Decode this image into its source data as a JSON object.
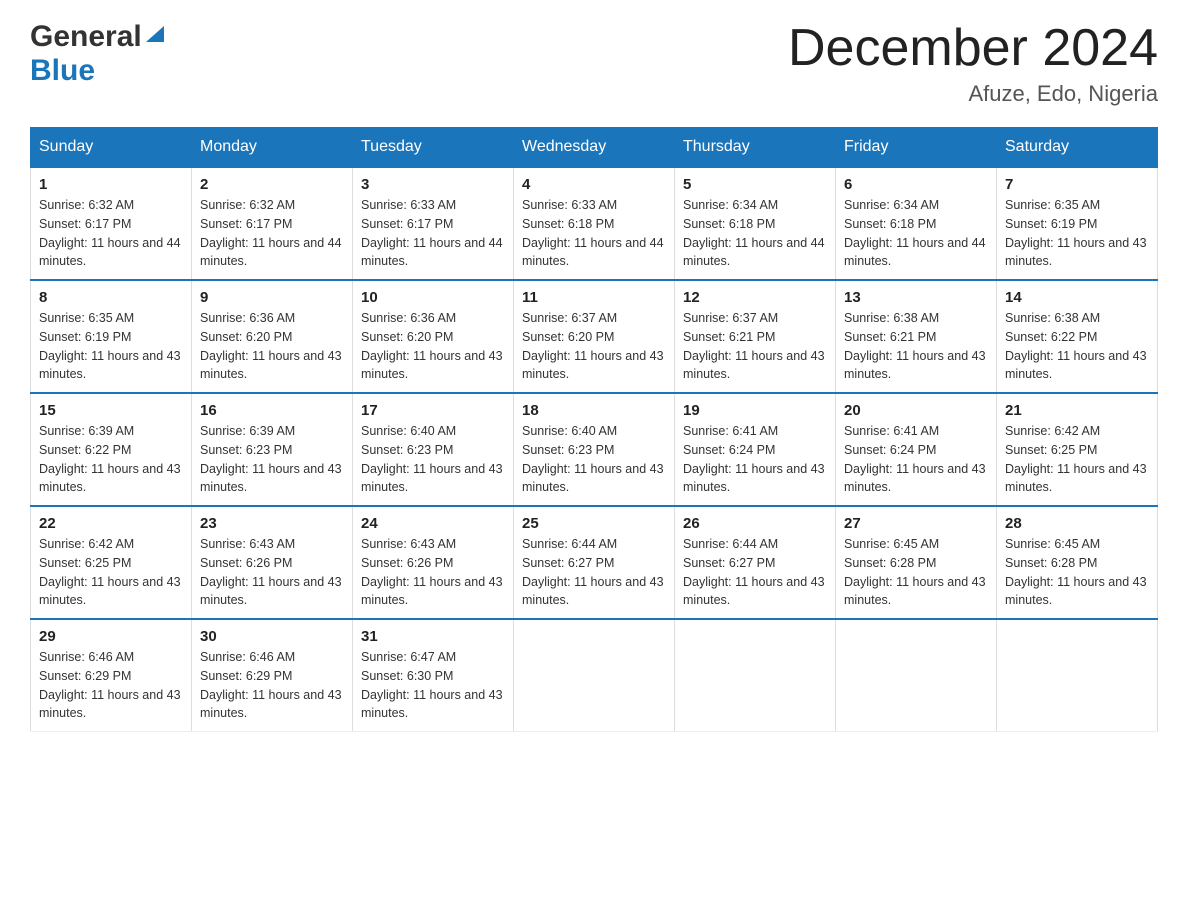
{
  "logo": {
    "general": "General",
    "blue": "Blue",
    "triangle_color": "#1a75bb"
  },
  "title": {
    "month_year": "December 2024",
    "location": "Afuze, Edo, Nigeria"
  },
  "headers": [
    "Sunday",
    "Monday",
    "Tuesday",
    "Wednesday",
    "Thursday",
    "Friday",
    "Saturday"
  ],
  "weeks": [
    [
      {
        "day": "1",
        "sunrise": "Sunrise: 6:32 AM",
        "sunset": "Sunset: 6:17 PM",
        "daylight": "Daylight: 11 hours and 44 minutes."
      },
      {
        "day": "2",
        "sunrise": "Sunrise: 6:32 AM",
        "sunset": "Sunset: 6:17 PM",
        "daylight": "Daylight: 11 hours and 44 minutes."
      },
      {
        "day": "3",
        "sunrise": "Sunrise: 6:33 AM",
        "sunset": "Sunset: 6:17 PM",
        "daylight": "Daylight: 11 hours and 44 minutes."
      },
      {
        "day": "4",
        "sunrise": "Sunrise: 6:33 AM",
        "sunset": "Sunset: 6:18 PM",
        "daylight": "Daylight: 11 hours and 44 minutes."
      },
      {
        "day": "5",
        "sunrise": "Sunrise: 6:34 AM",
        "sunset": "Sunset: 6:18 PM",
        "daylight": "Daylight: 11 hours and 44 minutes."
      },
      {
        "day": "6",
        "sunrise": "Sunrise: 6:34 AM",
        "sunset": "Sunset: 6:18 PM",
        "daylight": "Daylight: 11 hours and 44 minutes."
      },
      {
        "day": "7",
        "sunrise": "Sunrise: 6:35 AM",
        "sunset": "Sunset: 6:19 PM",
        "daylight": "Daylight: 11 hours and 43 minutes."
      }
    ],
    [
      {
        "day": "8",
        "sunrise": "Sunrise: 6:35 AM",
        "sunset": "Sunset: 6:19 PM",
        "daylight": "Daylight: 11 hours and 43 minutes."
      },
      {
        "day": "9",
        "sunrise": "Sunrise: 6:36 AM",
        "sunset": "Sunset: 6:20 PM",
        "daylight": "Daylight: 11 hours and 43 minutes."
      },
      {
        "day": "10",
        "sunrise": "Sunrise: 6:36 AM",
        "sunset": "Sunset: 6:20 PM",
        "daylight": "Daylight: 11 hours and 43 minutes."
      },
      {
        "day": "11",
        "sunrise": "Sunrise: 6:37 AM",
        "sunset": "Sunset: 6:20 PM",
        "daylight": "Daylight: 11 hours and 43 minutes."
      },
      {
        "day": "12",
        "sunrise": "Sunrise: 6:37 AM",
        "sunset": "Sunset: 6:21 PM",
        "daylight": "Daylight: 11 hours and 43 minutes."
      },
      {
        "day": "13",
        "sunrise": "Sunrise: 6:38 AM",
        "sunset": "Sunset: 6:21 PM",
        "daylight": "Daylight: 11 hours and 43 minutes."
      },
      {
        "day": "14",
        "sunrise": "Sunrise: 6:38 AM",
        "sunset": "Sunset: 6:22 PM",
        "daylight": "Daylight: 11 hours and 43 minutes."
      }
    ],
    [
      {
        "day": "15",
        "sunrise": "Sunrise: 6:39 AM",
        "sunset": "Sunset: 6:22 PM",
        "daylight": "Daylight: 11 hours and 43 minutes."
      },
      {
        "day": "16",
        "sunrise": "Sunrise: 6:39 AM",
        "sunset": "Sunset: 6:23 PM",
        "daylight": "Daylight: 11 hours and 43 minutes."
      },
      {
        "day": "17",
        "sunrise": "Sunrise: 6:40 AM",
        "sunset": "Sunset: 6:23 PM",
        "daylight": "Daylight: 11 hours and 43 minutes."
      },
      {
        "day": "18",
        "sunrise": "Sunrise: 6:40 AM",
        "sunset": "Sunset: 6:23 PM",
        "daylight": "Daylight: 11 hours and 43 minutes."
      },
      {
        "day": "19",
        "sunrise": "Sunrise: 6:41 AM",
        "sunset": "Sunset: 6:24 PM",
        "daylight": "Daylight: 11 hours and 43 minutes."
      },
      {
        "day": "20",
        "sunrise": "Sunrise: 6:41 AM",
        "sunset": "Sunset: 6:24 PM",
        "daylight": "Daylight: 11 hours and 43 minutes."
      },
      {
        "day": "21",
        "sunrise": "Sunrise: 6:42 AM",
        "sunset": "Sunset: 6:25 PM",
        "daylight": "Daylight: 11 hours and 43 minutes."
      }
    ],
    [
      {
        "day": "22",
        "sunrise": "Sunrise: 6:42 AM",
        "sunset": "Sunset: 6:25 PM",
        "daylight": "Daylight: 11 hours and 43 minutes."
      },
      {
        "day": "23",
        "sunrise": "Sunrise: 6:43 AM",
        "sunset": "Sunset: 6:26 PM",
        "daylight": "Daylight: 11 hours and 43 minutes."
      },
      {
        "day": "24",
        "sunrise": "Sunrise: 6:43 AM",
        "sunset": "Sunset: 6:26 PM",
        "daylight": "Daylight: 11 hours and 43 minutes."
      },
      {
        "day": "25",
        "sunrise": "Sunrise: 6:44 AM",
        "sunset": "Sunset: 6:27 PM",
        "daylight": "Daylight: 11 hours and 43 minutes."
      },
      {
        "day": "26",
        "sunrise": "Sunrise: 6:44 AM",
        "sunset": "Sunset: 6:27 PM",
        "daylight": "Daylight: 11 hours and 43 minutes."
      },
      {
        "day": "27",
        "sunrise": "Sunrise: 6:45 AM",
        "sunset": "Sunset: 6:28 PM",
        "daylight": "Daylight: 11 hours and 43 minutes."
      },
      {
        "day": "28",
        "sunrise": "Sunrise: 6:45 AM",
        "sunset": "Sunset: 6:28 PM",
        "daylight": "Daylight: 11 hours and 43 minutes."
      }
    ],
    [
      {
        "day": "29",
        "sunrise": "Sunrise: 6:46 AM",
        "sunset": "Sunset: 6:29 PM",
        "daylight": "Daylight: 11 hours and 43 minutes."
      },
      {
        "day": "30",
        "sunrise": "Sunrise: 6:46 AM",
        "sunset": "Sunset: 6:29 PM",
        "daylight": "Daylight: 11 hours and 43 minutes."
      },
      {
        "day": "31",
        "sunrise": "Sunrise: 6:47 AM",
        "sunset": "Sunset: 6:30 PM",
        "daylight": "Daylight: 11 hours and 43 minutes."
      },
      null,
      null,
      null,
      null
    ]
  ]
}
